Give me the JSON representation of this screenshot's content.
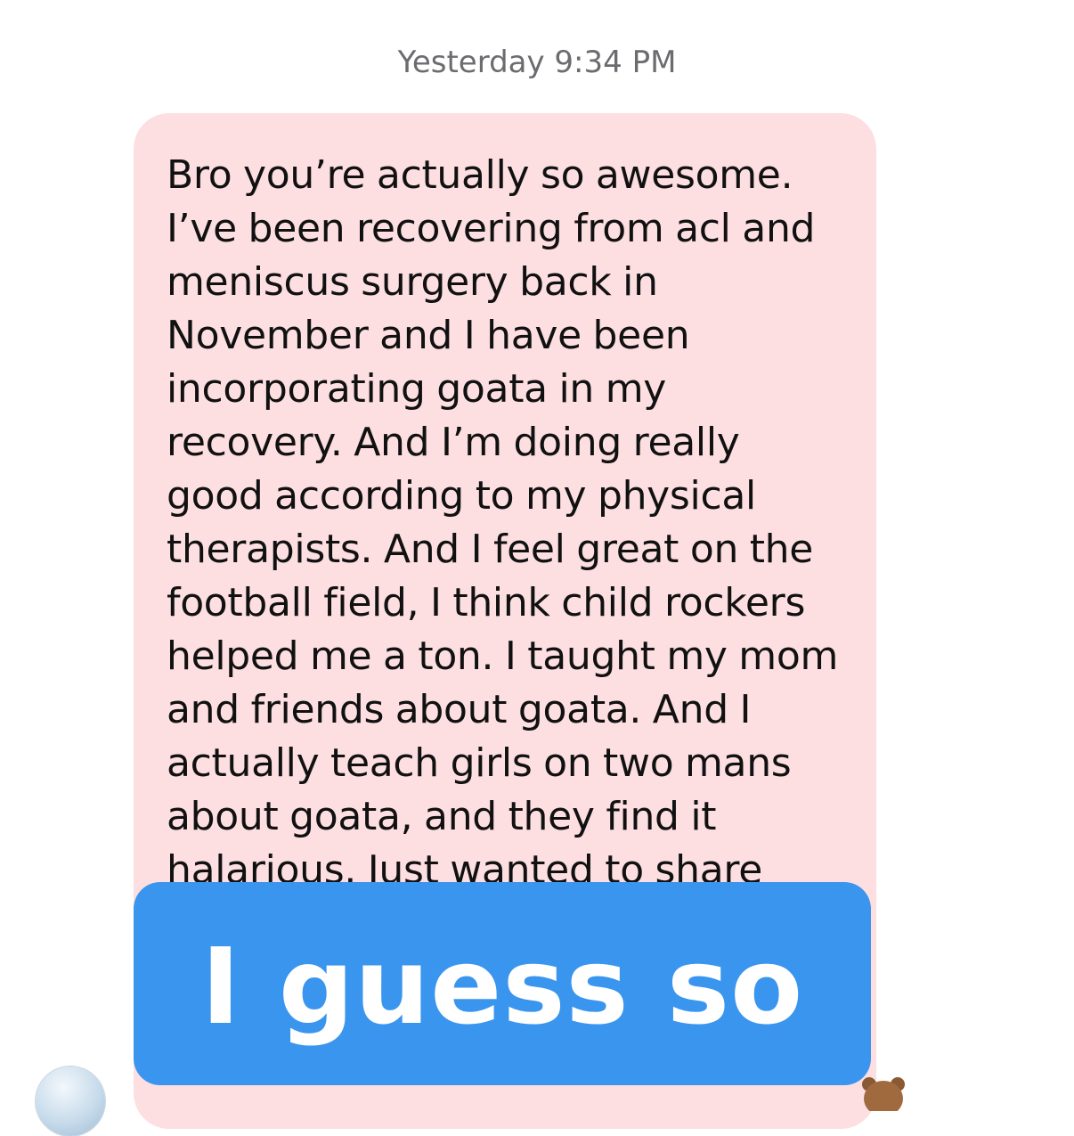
{
  "conversation": {
    "timestamp": "Yesterday 9:34 PM",
    "message": {
      "text": "Bro you’re actually so awesome. I’ve been recovering from acl and meniscus surgery back in November and I have been incorporating goata in my recovery. And I’m doing really good according to my physical therapists. And I feel great on the football field, I think child rockers helped me a ton. I taught my mom and friends about goata. And I actually teach girls on two mans about goata, and they find it halarious. Just wanted to share",
      "partially_hidden_text": "work."
    },
    "overlay_caption": "I guess so",
    "reaction_icon": "bear-emoji-icon",
    "avatar_icon": "contact-avatar-icon"
  },
  "colors": {
    "bubble_background": "#fddfe2",
    "caption_background": "#3a95ee",
    "timestamp_text": "#6c6c70"
  }
}
